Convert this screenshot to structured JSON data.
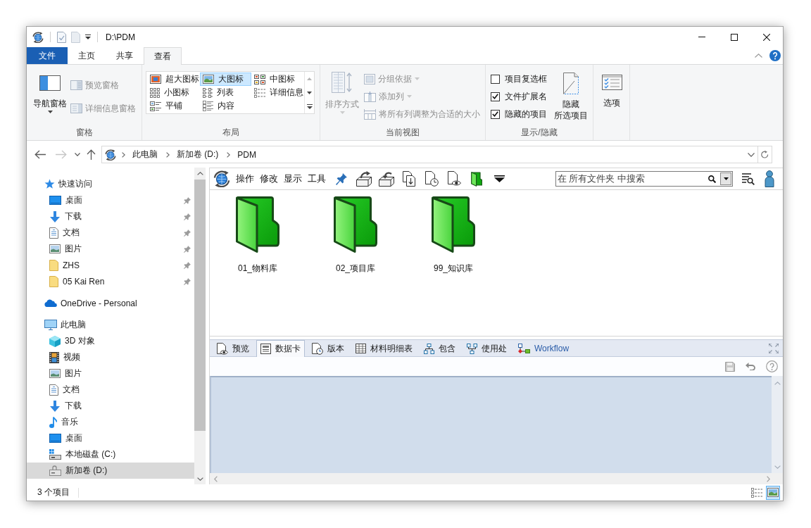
{
  "window": {
    "title": "D:\\PDM"
  },
  "ribbon_tabs": [
    {
      "label": "文件",
      "kind": "file",
      "selected": false
    },
    {
      "label": "主页",
      "kind": "tab",
      "selected": false
    },
    {
      "label": "共享",
      "kind": "tab",
      "selected": false
    },
    {
      "label": "查看",
      "kind": "tab",
      "selected": true
    }
  ],
  "ribbon": {
    "panes": {
      "title": "窗格",
      "navigation_pane": {
        "label": "导航窗格"
      },
      "buttons": [
        {
          "label": "预览窗格",
          "kind": "preview",
          "disabled": true
        },
        {
          "label": "详细信息窗格",
          "kind": "details",
          "disabled": true
        }
      ]
    },
    "layout": {
      "title": "布局",
      "options": [
        {
          "label": "超大图标",
          "kind": "extra-large",
          "selected": false
        },
        {
          "label": "大图标",
          "kind": "large",
          "selected": true
        },
        {
          "label": "中图标",
          "kind": "medium",
          "selected": false
        },
        {
          "label": "小图标",
          "kind": "small",
          "selected": false
        },
        {
          "label": "列表",
          "kind": "list",
          "selected": false
        },
        {
          "label": "详细信息",
          "kind": "details",
          "selected": false
        },
        {
          "label": "平铺",
          "kind": "tiles",
          "selected": false
        },
        {
          "label": "内容",
          "kind": "content",
          "selected": false
        }
      ]
    },
    "current_view": {
      "title": "当前视图",
      "sort": {
        "label": "排序方式",
        "disabled": true
      },
      "buttons": [
        {
          "label": "分组依据",
          "kind": "group",
          "dropdown": true,
          "disabled": true
        },
        {
          "label": "添加列",
          "kind": "add-column",
          "dropdown": true,
          "disabled": true
        },
        {
          "label": "将所有列调整为合适的大小",
          "kind": "fit",
          "dropdown": false,
          "disabled": true
        }
      ]
    },
    "show_hide": {
      "title": "显示/隐藏",
      "checkboxes": [
        {
          "label": "项目复选框",
          "checked": false
        },
        {
          "label": "文件扩展名",
          "checked": true
        },
        {
          "label": "隐藏的项目",
          "checked": true
        }
      ],
      "hide_selected": {
        "label_lines": [
          "隐藏",
          "所选项目"
        ]
      }
    },
    "options": {
      "label": "选项"
    }
  },
  "navigation": [
    {
      "kind": "back",
      "disabled": false
    },
    {
      "kind": "forward",
      "disabled": true
    },
    {
      "kind": "recent",
      "disabled": false
    },
    {
      "kind": "up",
      "disabled": false
    }
  ],
  "address": {
    "path": [
      "此电脑",
      "新加卷 (D:)",
      "PDM"
    ]
  },
  "sidebar": {
    "sections": [
      {
        "label": "快速访问",
        "kind": "star",
        "selected": false,
        "children": [
          {
            "label": "桌面",
            "kind": "desktop",
            "pinned": true,
            "selected": false
          },
          {
            "label": "下载",
            "kind": "downloads",
            "pinned": true,
            "selected": false
          },
          {
            "label": "文档",
            "kind": "documents",
            "pinned": true,
            "selected": false
          },
          {
            "label": "图片",
            "kind": "pictures",
            "pinned": true,
            "selected": false
          },
          {
            "label": "ZHS",
            "kind": "folder",
            "pinned": true,
            "selected": false
          },
          {
            "label": "05 Kai Ren",
            "kind": "folder",
            "pinned": true,
            "selected": false
          }
        ]
      },
      {
        "label": "OneDrive - Personal",
        "kind": "cloud",
        "selected": false
      },
      {
        "label": "此电脑",
        "kind": "computer",
        "selected": false,
        "children": [
          {
            "label": "3D 对象",
            "kind": "cube",
            "pinned": false,
            "selected": false
          },
          {
            "label": "视频",
            "kind": "video",
            "pinned": false,
            "selected": false
          },
          {
            "label": "图片",
            "kind": "pictures",
            "pinned": false,
            "selected": false
          },
          {
            "label": "文档",
            "kind": "documents",
            "pinned": false,
            "selected": false
          },
          {
            "label": "下载",
            "kind": "downloads",
            "pinned": false,
            "selected": false
          },
          {
            "label": "音乐",
            "kind": "music",
            "pinned": false,
            "selected": false
          },
          {
            "label": "桌面",
            "kind": "desktop",
            "pinned": false,
            "selected": false
          },
          {
            "label": "本地磁盘 (C:)",
            "kind": "system-drive",
            "pinned": false,
            "selected": false
          },
          {
            "label": "新加卷 (D:)",
            "kind": "vault-drive",
            "pinned": false,
            "selected": true
          }
        ]
      }
    ]
  },
  "vault_toolbar": {
    "menus": [
      "操作",
      "修改",
      "显示",
      "工具"
    ],
    "search": {
      "placeholder": "在 所有文件夹 中搜索"
    }
  },
  "files": [
    {
      "name": "01_物料库",
      "selected": false
    },
    {
      "name": "02_项目库",
      "selected": false
    },
    {
      "name": "99_知识库",
      "selected": false
    }
  ],
  "detail_tabs": [
    {
      "label": "预览",
      "kind": "preview",
      "selected": false
    },
    {
      "label": "数据卡",
      "kind": "data-card",
      "selected": true
    },
    {
      "label": "版本",
      "kind": "version",
      "selected": false
    },
    {
      "label": "材料明细表",
      "kind": "bom",
      "selected": false
    },
    {
      "label": "包含",
      "kind": "contains",
      "selected": false
    },
    {
      "label": "使用处",
      "kind": "where-used",
      "selected": false
    },
    {
      "label": "Workflow",
      "kind": "workflow",
      "selected": false
    }
  ],
  "status_bar": {
    "item_count": "3 个项目",
    "view_modes": [
      {
        "kind": "details",
        "selected": false
      },
      {
        "kind": "large-icons",
        "selected": true
      }
    ]
  }
}
